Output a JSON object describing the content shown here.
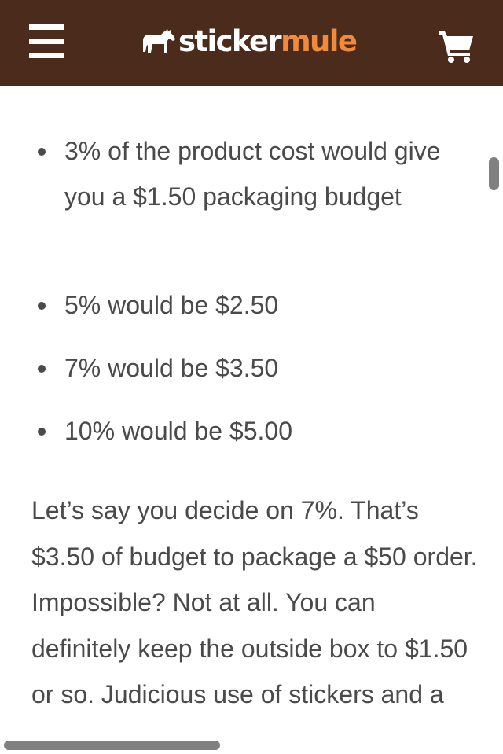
{
  "header": {
    "logo_part1": "sticker",
    "logo_part2": "mule",
    "bg_color": "#4a2b1c",
    "accent_color": "#f08a3c",
    "menu_icon": "hamburger-menu-icon",
    "cart_icon": "shopping-cart-icon",
    "logo_icon": "mule-icon"
  },
  "article": {
    "bullets": [
      "3% of the product cost would give you a $1.50 packaging budget",
      "5% would be $2.50",
      "7% would be $3.50",
      "10% would be $5.00"
    ],
    "paragraph": "Let’s say you decide on 7%. That’s $3.50 of budget to package a $50 order. Impossible? Not at all. You can definitely keep the outside box to $1.50 or so. Judicious use of stickers and a"
  }
}
